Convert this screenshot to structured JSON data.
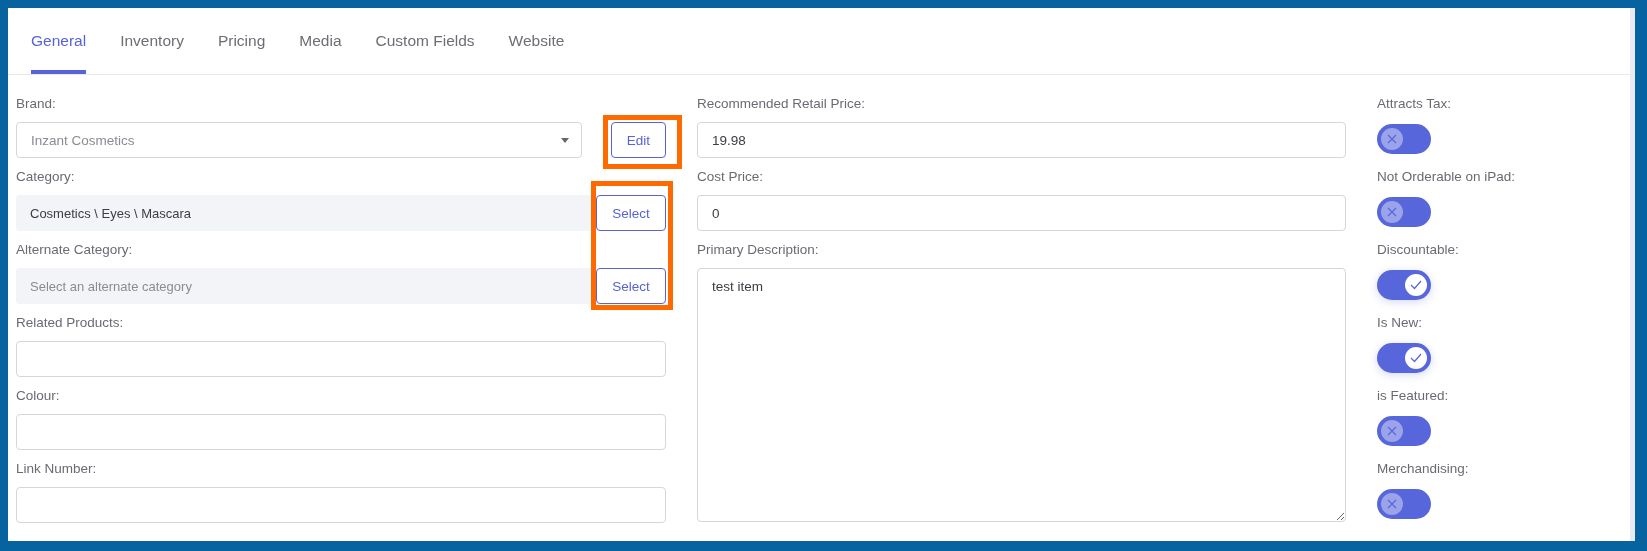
{
  "tabs": [
    {
      "label": "General",
      "selected": true
    },
    {
      "label": "Inventory",
      "selected": false
    },
    {
      "label": "Pricing",
      "selected": false
    },
    {
      "label": "Media",
      "selected": false
    },
    {
      "label": "Custom Fields",
      "selected": false
    },
    {
      "label": "Website",
      "selected": false
    }
  ],
  "left": {
    "brand": {
      "label": "Brand:",
      "value": "Inzant Cosmetics",
      "button": "Edit",
      "button_highlighted": true
    },
    "select_buttons_highlighted": true,
    "category": {
      "label": "Category:",
      "value": "Cosmetics \\ Eyes \\ Mascara",
      "button": "Select"
    },
    "alternate_category": {
      "label": "Alternate Category:",
      "placeholder": "Select an alternate category",
      "button": "Select"
    },
    "fields": [
      {
        "label": "Related Products:"
      },
      {
        "label": "Colour:"
      },
      {
        "label": "Link Number:"
      }
    ]
  },
  "middle": {
    "fields": [
      {
        "label": "Recommended Retail Price:",
        "value": "19.98"
      },
      {
        "label": "Cost Price:",
        "value": "0"
      }
    ],
    "description": {
      "label": "Primary Description:",
      "value": "test item"
    }
  },
  "toggles": [
    {
      "label": "Attracts Tax:",
      "on": false
    },
    {
      "label": "Not Orderable on iPad:",
      "on": false
    },
    {
      "label": "Discountable:",
      "on": true
    },
    {
      "label": "Is New:",
      "on": true
    },
    {
      "label": "is Featured:",
      "on": false
    },
    {
      "label": "Merchandising:",
      "on": false
    }
  ]
}
